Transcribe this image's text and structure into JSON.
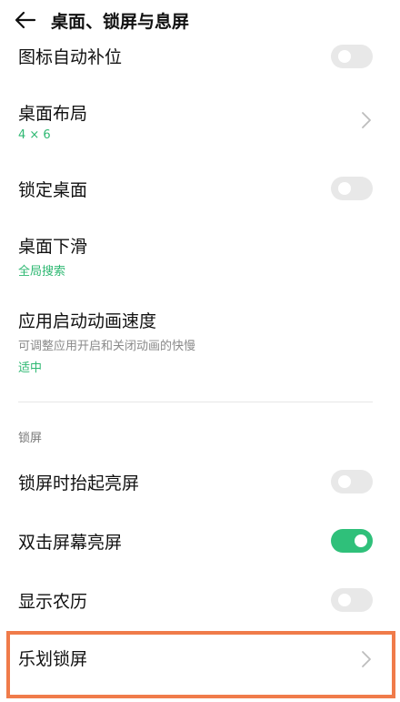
{
  "header": {
    "title": "桌面、锁屏与息屏",
    "back_icon": "back-arrow-icon"
  },
  "items": [
    {
      "title": "图标自动补位",
      "control": "toggle",
      "state": "off"
    },
    {
      "title": "桌面布局",
      "value": "4 × 6",
      "control": "chevron"
    },
    {
      "title": "锁定桌面",
      "control": "toggle",
      "state": "off"
    },
    {
      "title": "桌面下滑",
      "value": "全局搜索"
    },
    {
      "title": "应用启动动画速度",
      "subtitle": "可调整应用开启和关闭动画的快慢",
      "value": "适中"
    }
  ],
  "lock_section": {
    "label": "锁屏",
    "items": [
      {
        "title": "锁屏时抬起亮屏",
        "control": "toggle",
        "state": "off"
      },
      {
        "title": "双击屏幕亮屏",
        "control": "toggle",
        "state": "on"
      },
      {
        "title": "显示农历",
        "control": "toggle",
        "state": "off"
      },
      {
        "title": "乐划锁屏",
        "control": "chevron",
        "highlighted": true
      }
    ]
  },
  "colors": {
    "accent_green": "#2eb872",
    "toggle_on": "#2fc07a",
    "toggle_off": "#e8e8e8",
    "highlight": "#f07b4a"
  }
}
